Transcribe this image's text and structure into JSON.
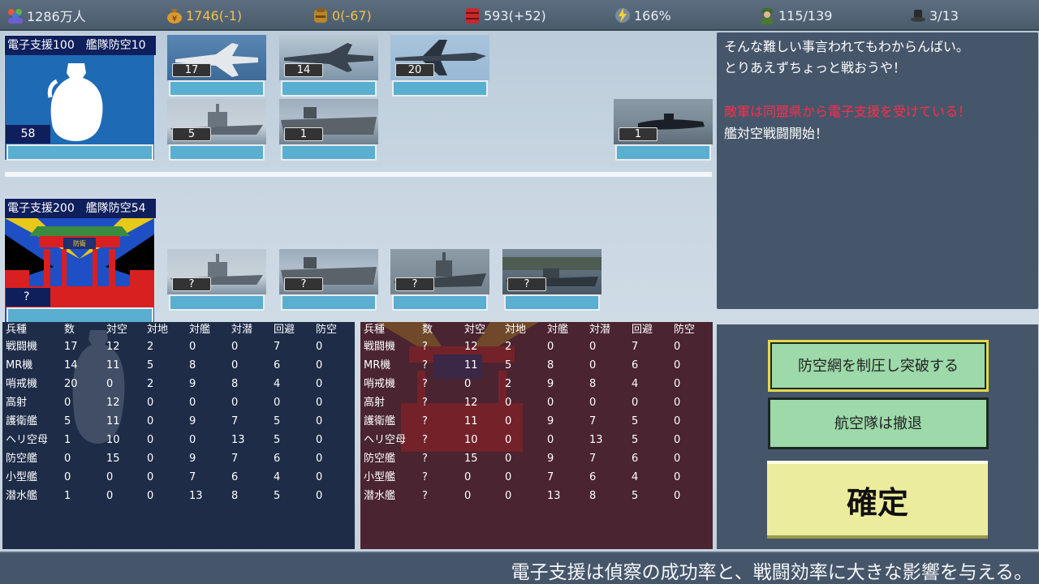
{
  "resources": {
    "population": "1286万人",
    "money": "1746(-1)",
    "supplies": "0(-67)",
    "fuel": "593(+52)",
    "efficiency": "166%",
    "troops": "115/139",
    "turn": "3/13"
  },
  "own_commander": {
    "title": "電子支援100　艦隊防空10",
    "count": "58"
  },
  "own_units": [
    {
      "name": "fighter",
      "count": "17"
    },
    {
      "name": "mr-plane",
      "count": "14"
    },
    {
      "name": "patrol-plane",
      "count": "20"
    },
    {
      "name": "escort-ship",
      "count": "5"
    },
    {
      "name": "heli-carrier",
      "count": "1"
    },
    {
      "name": "submarine",
      "count": "1"
    }
  ],
  "enemy_commander": {
    "title": "電子支援200　艦隊防空54",
    "count": "?"
  },
  "enemy_units": [
    {
      "name": "enemy-ship-1",
      "count": "?"
    },
    {
      "name": "enemy-ship-2",
      "count": "?"
    },
    {
      "name": "enemy-ship-3",
      "count": "?"
    },
    {
      "name": "enemy-ship-4",
      "count": "?"
    }
  ],
  "messages": [
    {
      "text": "そんな難しい事言われてもわからんばい。",
      "color": "#ffffff"
    },
    {
      "text": "とりあえずちょっと戦おうや！",
      "color": "#ffffff"
    },
    {
      "text": "敵軍は同盟県から電子支援を受けている！",
      "color": "#ff2c4a"
    },
    {
      "text": "艦対空戦闘開始！",
      "color": "#ffffff"
    }
  ],
  "stat_headers": [
    "兵種",
    "数",
    "対空",
    "対地",
    "対艦",
    "対潜",
    "回避",
    "防空"
  ],
  "own_stats": [
    [
      "戦闘機",
      "17",
      "12",
      "2",
      "0",
      "0",
      "7",
      "0"
    ],
    [
      "MR機",
      "14",
      "11",
      "5",
      "8",
      "0",
      "6",
      "0"
    ],
    [
      "哨戒機",
      "20",
      "0",
      "2",
      "9",
      "8",
      "4",
      "0"
    ],
    [
      "高射",
      "0",
      "12",
      "0",
      "0",
      "0",
      "0",
      "0"
    ],
    [
      "護衛艦",
      "5",
      "11",
      "0",
      "9",
      "7",
      "5",
      "0"
    ],
    [
      "ヘリ空母",
      "1",
      "10",
      "0",
      "0",
      "13",
      "5",
      "0"
    ],
    [
      "防空艦",
      "0",
      "15",
      "0",
      "9",
      "7",
      "6",
      "0"
    ],
    [
      "小型艦",
      "0",
      "0",
      "0",
      "7",
      "6",
      "4",
      "0"
    ],
    [
      "潜水艦",
      "1",
      "0",
      "0",
      "13",
      "8",
      "5",
      "0"
    ]
  ],
  "enemy_stats": [
    [
      "戦闘機",
      "?",
      "12",
      "2",
      "0",
      "0",
      "7",
      "0"
    ],
    [
      "MR機",
      "?",
      "11",
      "5",
      "8",
      "0",
      "6",
      "0"
    ],
    [
      "哨戒機",
      "?",
      "0",
      "2",
      "9",
      "8",
      "4",
      "0"
    ],
    [
      "高射",
      "?",
      "12",
      "0",
      "0",
      "0",
      "0",
      "0"
    ],
    [
      "護衛艦",
      "?",
      "11",
      "0",
      "9",
      "7",
      "5",
      "0"
    ],
    [
      "ヘリ空母",
      "?",
      "10",
      "0",
      "0",
      "13",
      "5",
      "0"
    ],
    [
      "防空艦",
      "?",
      "15",
      "0",
      "9",
      "7",
      "6",
      "0"
    ],
    [
      "小型艦",
      "?",
      "0",
      "0",
      "7",
      "6",
      "4",
      "0"
    ],
    [
      "潜水艦",
      "?",
      "0",
      "0",
      "13",
      "8",
      "5",
      "0"
    ]
  ],
  "gate_sign": "防衛",
  "buttons": {
    "breakthrough": "防空網を制圧し突破する",
    "withdraw": "航空隊は撤退",
    "confirm": "確定"
  },
  "tip": "電子支援は偵察の成功率と、戦闘効率に大きな影響を与える。",
  "colors": {
    "own_table": "#1e2c48",
    "enemy_table": "#4a2430",
    "message_red": "#ff2c4a",
    "button_green": "#9dd9a9",
    "button_yellow": "#ecec9f"
  }
}
